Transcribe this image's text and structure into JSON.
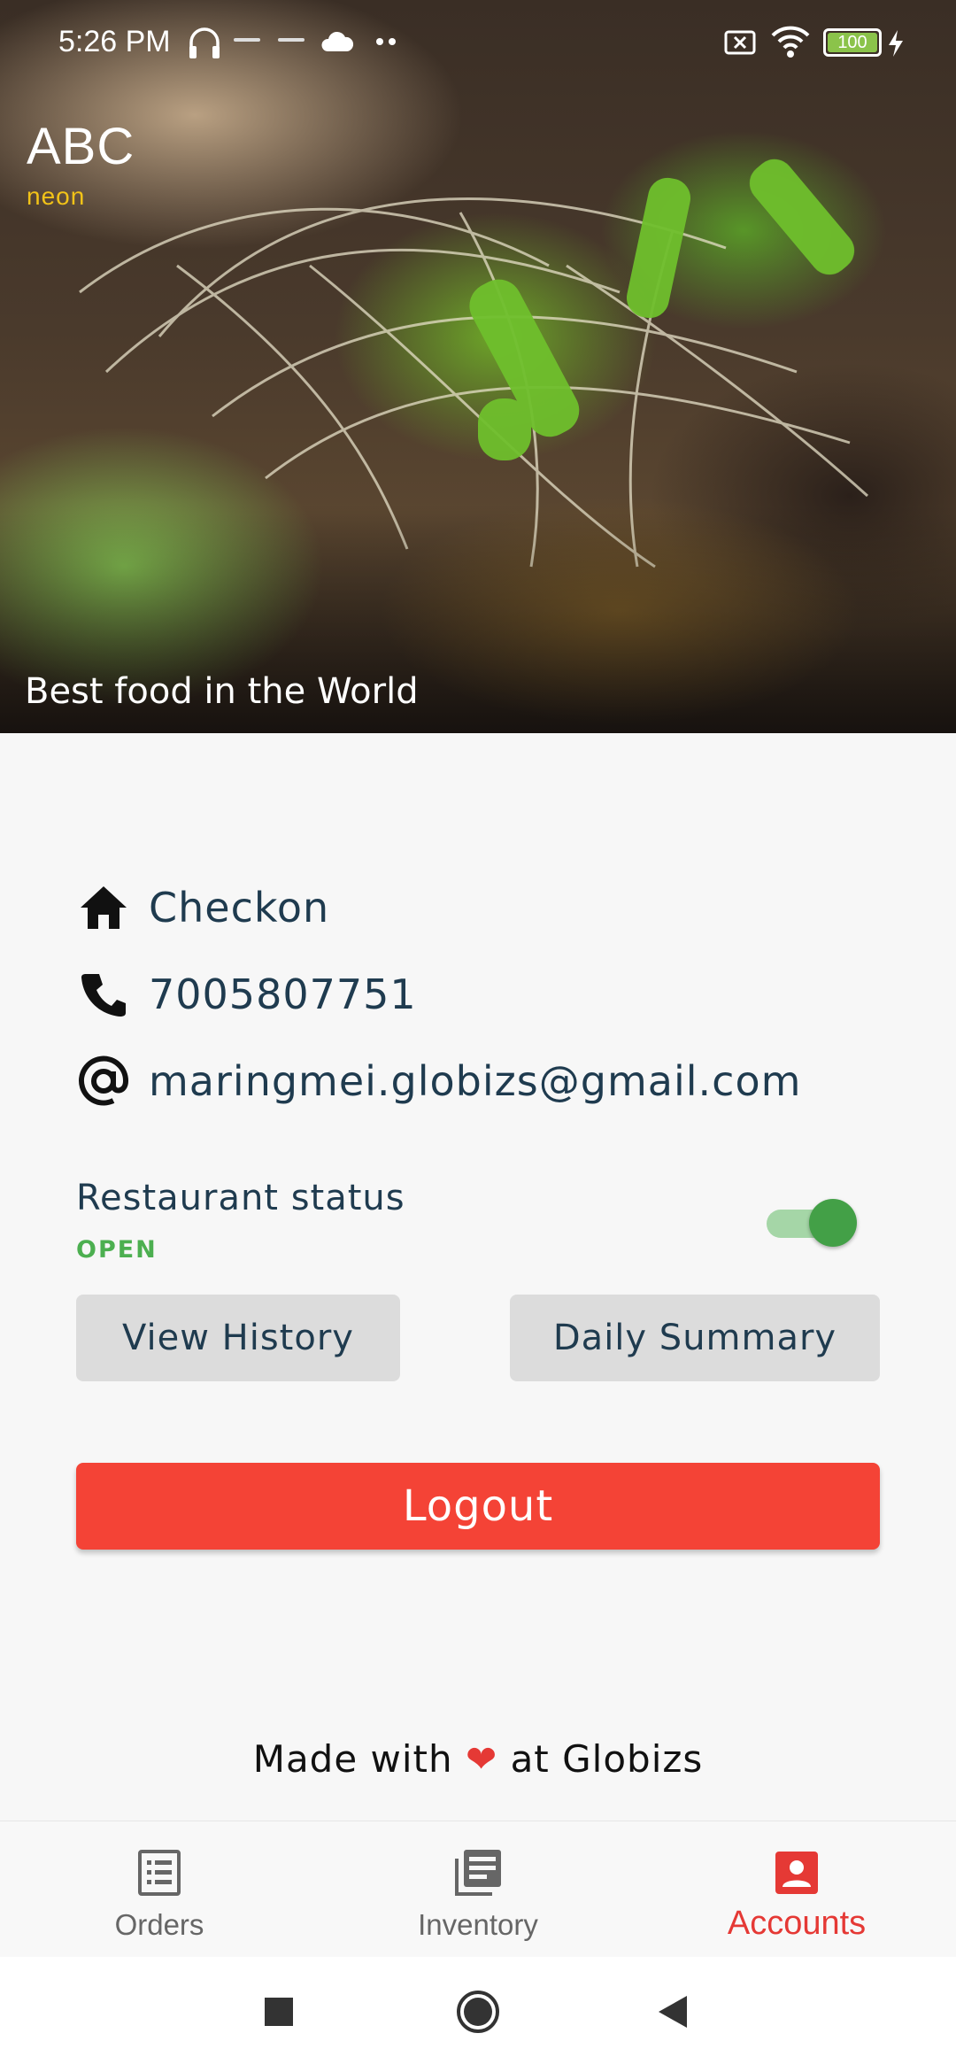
{
  "status_bar": {
    "time": "5:26 PM",
    "battery": "100",
    "icons": [
      "headphones-icon",
      "neon-notification-icon",
      "neon-notification-icon",
      "cloud-icon",
      "more-dots-icon",
      "sim-off-icon",
      "wifi-icon",
      "battery-icon",
      "charging-icon"
    ]
  },
  "header": {
    "brand": "ABC",
    "brand_sub": "neon",
    "tagline": "Best food in the World"
  },
  "profile": {
    "name": "Checkon",
    "phone": "7005807751",
    "email": "maringmei.globizs@gmail.com"
  },
  "restaurant": {
    "status_label": "Restaurant status",
    "status_value": "OPEN",
    "is_open": true
  },
  "actions": {
    "view_history": "View History",
    "daily_summary": "Daily Summary",
    "logout": "Logout"
  },
  "footer": {
    "made_with_prefix": "Made with",
    "made_with_suffix": "at Globizs"
  },
  "bottom_nav": {
    "items": [
      {
        "label": "Orders",
        "icon": "orders-list-icon"
      },
      {
        "label": "Inventory",
        "icon": "inventory-icon"
      },
      {
        "label": "Accounts",
        "icon": "account-icon",
        "active": true
      }
    ]
  },
  "colors": {
    "accent": "#e53935",
    "text_primary": "#1f3b4f",
    "open_green": "#4caf50",
    "logout_red": "#f44336"
  }
}
